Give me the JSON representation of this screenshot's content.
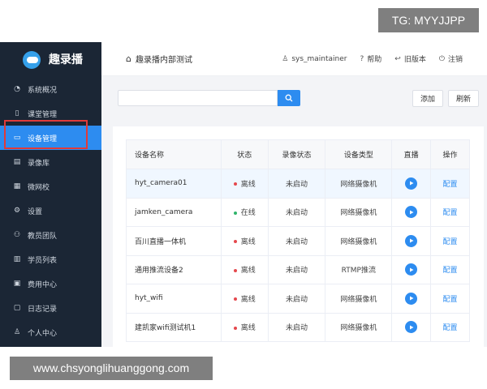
{
  "watermark_top": "TG: MYYJJPP",
  "watermark_bottom": "www.chsyonglihuanggong.com",
  "colors": {
    "sidebar_bg": "#1b2635",
    "accent": "#2d8cf0",
    "offline_dot": "#e5484d",
    "online_dot": "#2fb46a",
    "highlight_box": "#e03a3a"
  },
  "sidebar": {
    "logo_text": "趣录播",
    "items": [
      {
        "label": "系统概况",
        "icon": "dashboard-icon"
      },
      {
        "label": "课堂管理",
        "icon": "document-icon"
      },
      {
        "label": "设备管理",
        "icon": "camera-icon",
        "active": true
      },
      {
        "label": "录像库",
        "icon": "video-library-icon"
      },
      {
        "label": "微网校",
        "icon": "grid-icon"
      },
      {
        "label": "设置",
        "icon": "gear-icon"
      },
      {
        "label": "教员团队",
        "icon": "team-icon"
      },
      {
        "label": "学员列表",
        "icon": "student-list-icon"
      },
      {
        "label": "费用中心",
        "icon": "billing-icon"
      },
      {
        "label": "日志记录",
        "icon": "log-icon"
      },
      {
        "label": "个人中心",
        "icon": "user-icon"
      }
    ]
  },
  "header": {
    "title": "趣录播内部测试",
    "user": "sys_maintainer",
    "help": "帮助",
    "old_version": "旧版本",
    "logout": "注销"
  },
  "toolbar": {
    "search_placeholder": "",
    "add_label": "添加",
    "refresh_label": "刷新"
  },
  "table": {
    "columns": [
      "设备名称",
      "状态",
      "录像状态",
      "设备类型",
      "直播",
      "操作"
    ],
    "rows": [
      {
        "name": "hyt_camera01",
        "status": "离线",
        "status_type": "offline",
        "rec": "未启动",
        "type": "网络摄像机",
        "action": "配置"
      },
      {
        "name": "jamken_camera",
        "status": "在线",
        "status_type": "online",
        "rec": "未启动",
        "type": "网络摄像机",
        "action": "配置"
      },
      {
        "name": "百川直播一体机",
        "status": "离线",
        "status_type": "offline",
        "rec": "未启动",
        "type": "网络摄像机",
        "action": "配置"
      },
      {
        "name": "通用推流设备2",
        "status": "离线",
        "status_type": "offline",
        "rec": "未启动",
        "type": "RTMP推流",
        "action": "配置"
      },
      {
        "name": "hyt_wifi",
        "status": "离线",
        "status_type": "offline",
        "rec": "未启动",
        "type": "网络摄像机",
        "action": "配置"
      },
      {
        "name": "建凯家wifi测试机1",
        "status": "离线",
        "status_type": "offline",
        "rec": "未启动",
        "type": "网络摄像机",
        "action": "配置"
      }
    ]
  }
}
